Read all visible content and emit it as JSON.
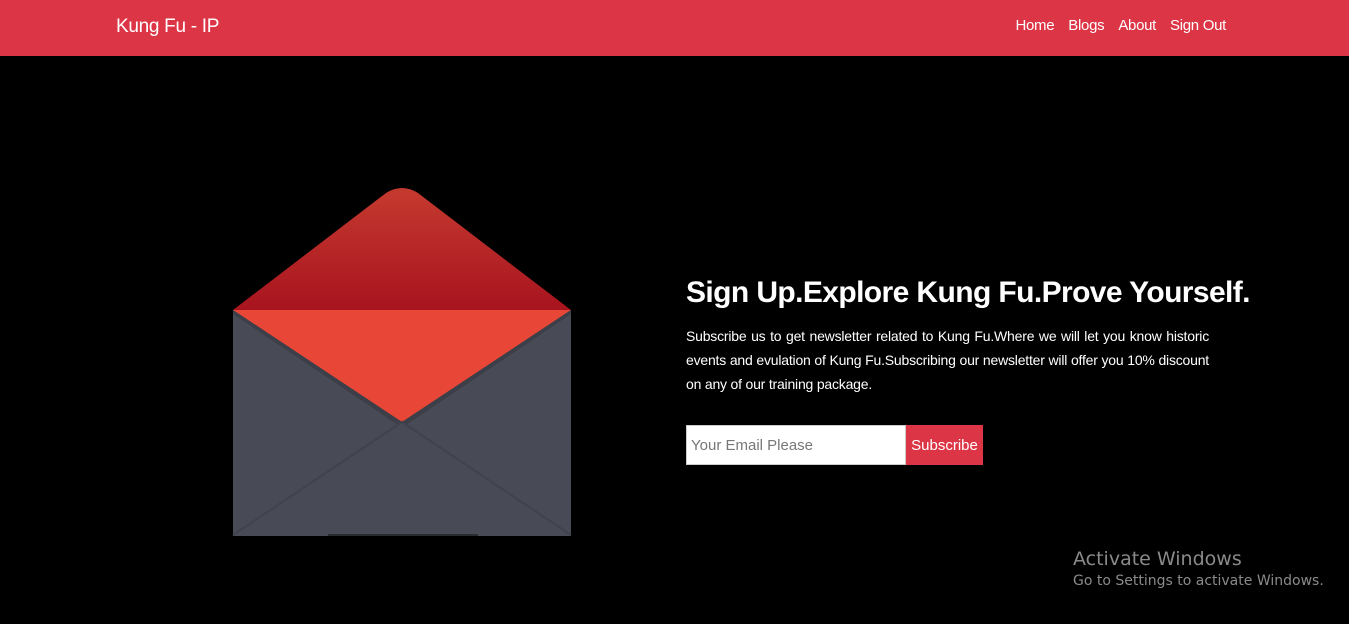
{
  "navbar": {
    "brand": "Kung Fu - IP",
    "links": [
      "Home",
      "Blogs",
      "About",
      "Sign Out"
    ],
    "bg_color": "#dc3545"
  },
  "hero": {
    "headline": "Sign Up.Explore Kung Fu.Prove Yourself.",
    "description": "Subscribe us to get newsletter related to Kung Fu.Where we will let you know historic events and evulation of Kung Fu.Subscribing our newsletter will offer you 10% discount on any of our training package.",
    "email_placeholder": "Your Email Please",
    "subscribe_label": "Subscribe"
  },
  "illustration": {
    "icon": "envelope-icon"
  },
  "watermark": {
    "title": "Activate Windows",
    "subtitle": "Go to Settings to activate Windows."
  }
}
